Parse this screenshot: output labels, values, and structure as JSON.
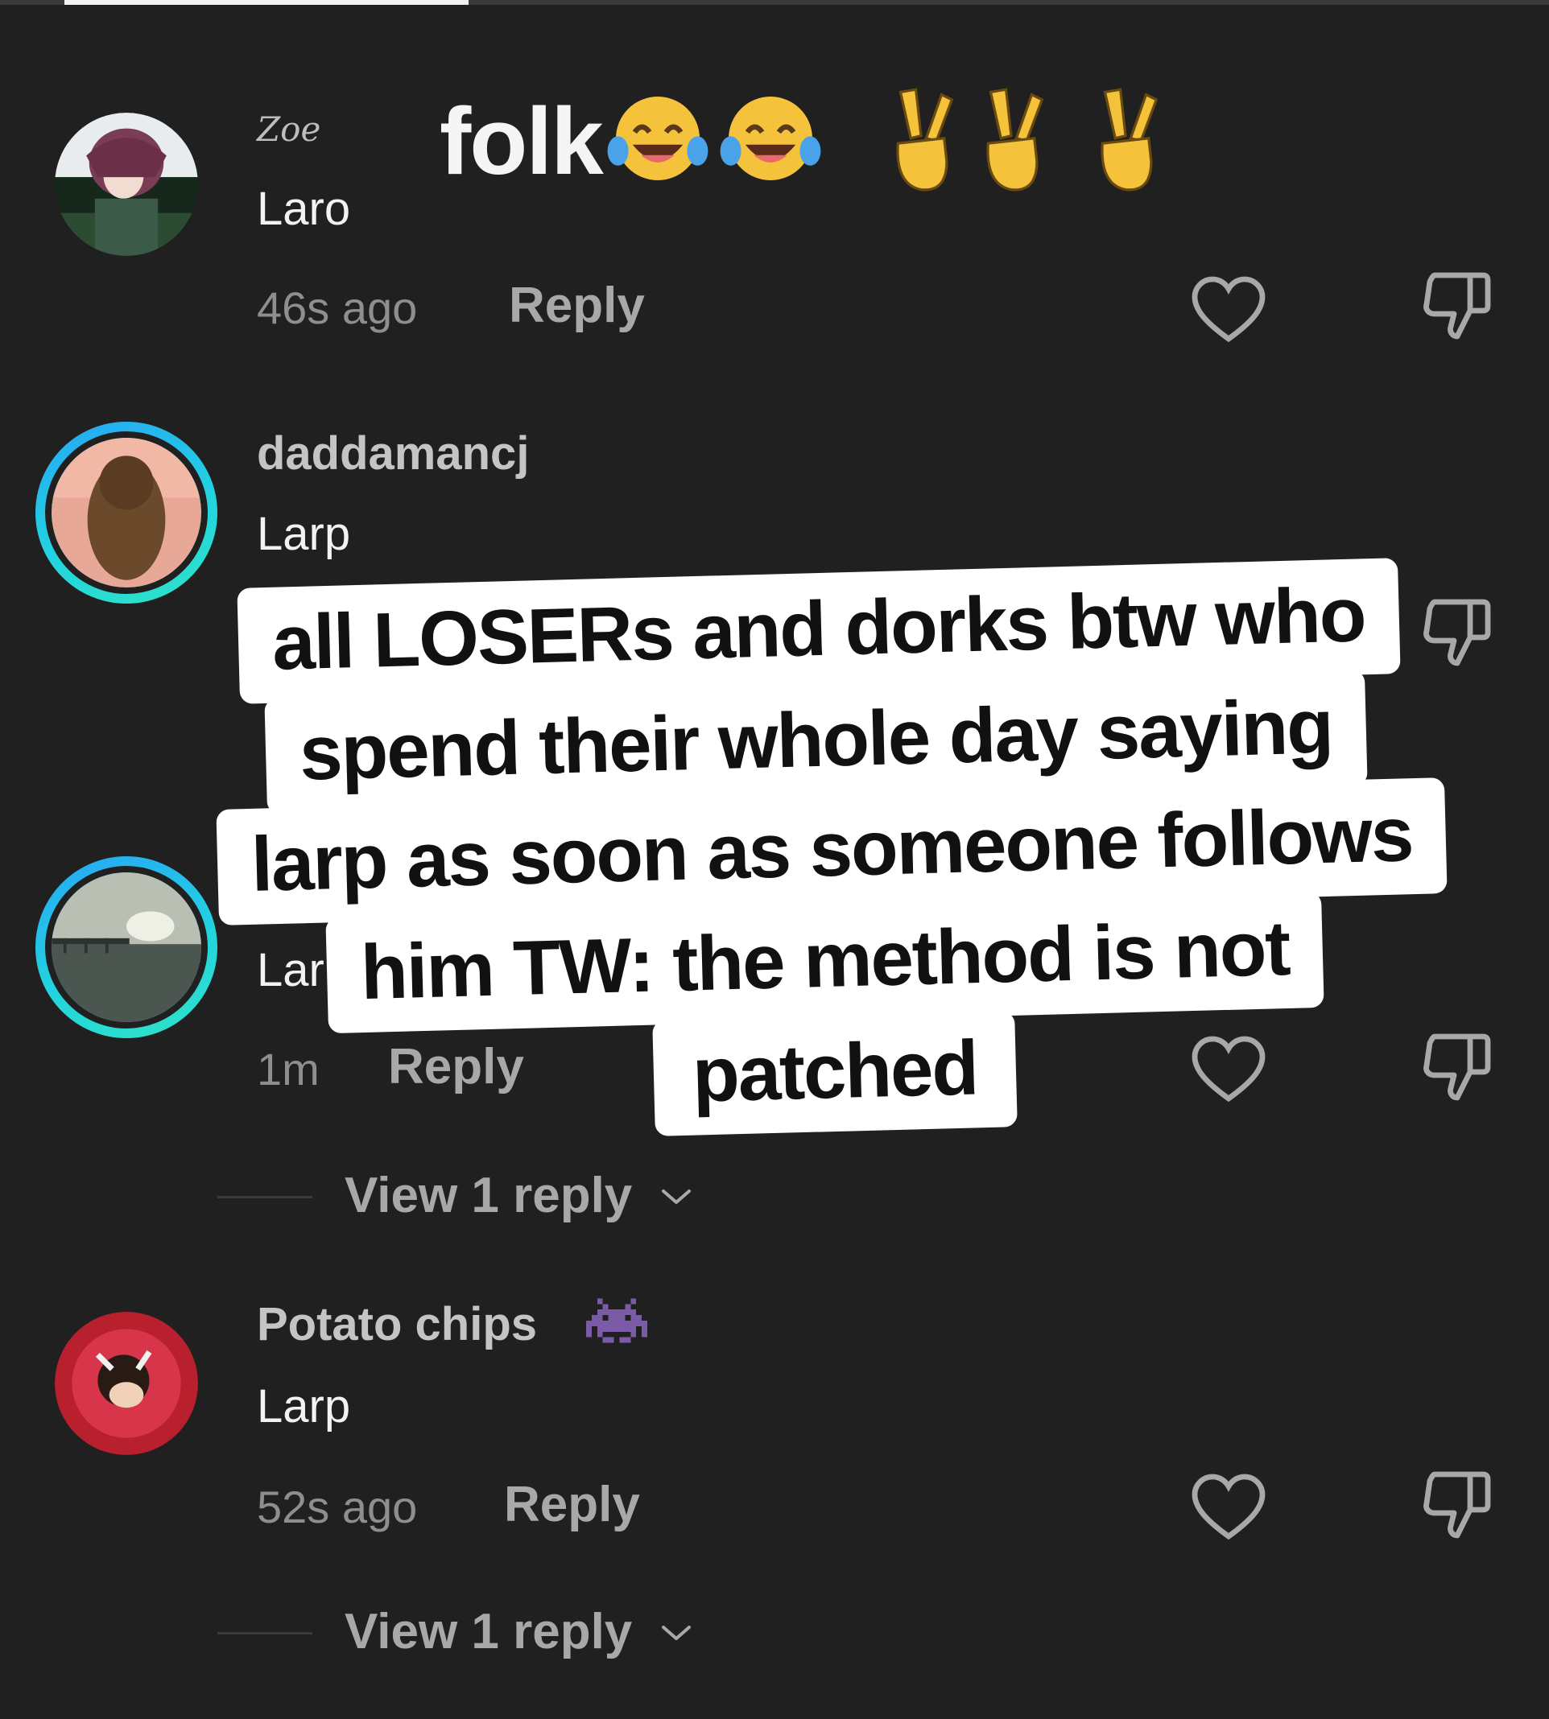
{
  "colors": {
    "background": "#202020",
    "ring_gradient_start": "#27a6f5",
    "ring_gradient_end": "#2fe3c6",
    "overlay_bg": "#ffffff",
    "overlay_text": "#111111"
  },
  "comments": [
    {
      "username": "Zoe",
      "body": "Laro",
      "timestamp": "46s ago",
      "reply_label": "Reply",
      "avatar": "anime-girl-avatar",
      "title_text": "folk",
      "title_emojis": [
        "tears-of-joy-emoji",
        "tears-of-joy-emoji",
        "victory-hand-emoji",
        "victory-hand-emoji",
        "victory-hand-emoji"
      ]
    },
    {
      "username": "daddamancj",
      "body": "Larp",
      "avatar": "long-hair-person-avatar",
      "has_story_ring": true
    },
    {
      "body_partial": "Lar",
      "timestamp": "1m",
      "reply_label": "Reply",
      "avatar": "sea-pier-avatar",
      "has_story_ring": true,
      "view_replies": "View 1 reply"
    },
    {
      "username": "Potato chips",
      "username_icon": "space-invader-icon",
      "body": "Larp",
      "timestamp": "52s ago",
      "reply_label": "Reply",
      "avatar": "anime-character-red-avatar",
      "view_replies": "View 1 reply"
    }
  ],
  "overlay_caption": {
    "lines": [
      "all LOSERs and dorks btw who",
      "spend their whole day saying",
      "larp as soon as someone follows",
      "him TW: the method is not",
      "patched"
    ]
  }
}
